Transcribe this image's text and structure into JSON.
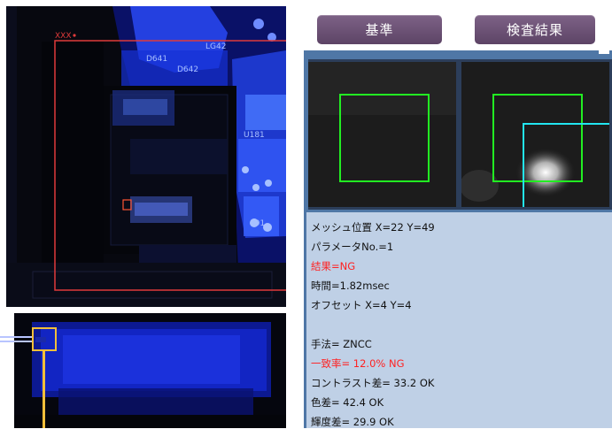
{
  "buttons": {
    "reference": "基準",
    "result": "検査結果"
  },
  "board": {
    "region_label": "XXX",
    "silk_labels": [
      "D641",
      "D642",
      "LG42",
      "U181",
      "191"
    ]
  },
  "info": {
    "mesh_position": "メッシュ位置 X=22 Y=49",
    "parameter_no": "パラメータNo.=1",
    "result": "結果=NG",
    "time": "時間=1.82msec",
    "offset": "オフセット X=4 Y=4",
    "method": "手法= ZNCC",
    "match_rate": "一致率= 12.0% NG",
    "contrast_diff": "コントラスト差= 33.2 OK",
    "color_diff": "色差= 42.4 OK",
    "brightness_diff": "輝度差= 29.9 OK"
  },
  "colors": {
    "ng_text": "#ff2222",
    "button_bg": "#6b5075",
    "panel_bg": "#4f77a6",
    "info_bg": "#bfd0e6",
    "inspection_rect": "#e03a3a",
    "search_window": "#22ee22",
    "offset_window": "#22e5f0",
    "detail_marker": "#f2bf3a"
  }
}
